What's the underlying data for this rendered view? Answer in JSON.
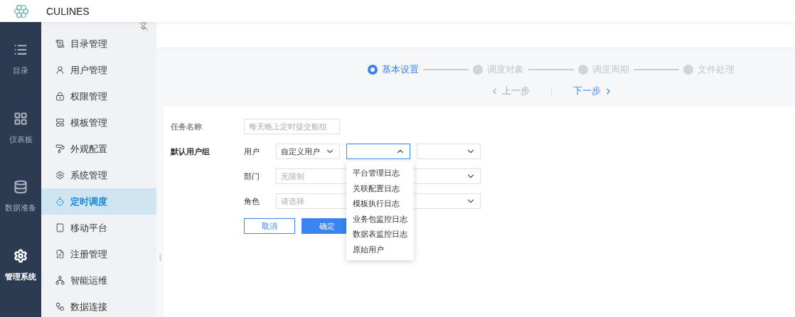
{
  "app": {
    "title": "CULINES"
  },
  "rail": [
    {
      "label": "目录",
      "selected": false
    },
    {
      "label": "仪表板",
      "selected": false
    },
    {
      "label": "数据准备",
      "selected": false
    },
    {
      "label": "管理系统",
      "selected": true
    }
  ],
  "menu": [
    {
      "label": "目录管理",
      "selected": false
    },
    {
      "label": "用户管理",
      "selected": false
    },
    {
      "label": "权限管理",
      "selected": false
    },
    {
      "label": "模板管理",
      "selected": false
    },
    {
      "label": "外观配置",
      "selected": false
    },
    {
      "label": "系统管理",
      "selected": false
    },
    {
      "label": "定时调度",
      "selected": true
    },
    {
      "label": "移动平台",
      "selected": false
    },
    {
      "label": "注册管理",
      "selected": false
    },
    {
      "label": "智能运维",
      "selected": false
    },
    {
      "label": "数据连接",
      "selected": false
    }
  ],
  "steps": [
    {
      "label": "基本设置",
      "selected": true
    },
    {
      "label": "调度对象",
      "selected": false
    },
    {
      "label": "调度周期",
      "selected": false
    },
    {
      "label": "文件处理",
      "selected": false
    }
  ],
  "nav": {
    "prev": {
      "label": "上一步",
      "disabled": true
    },
    "next": {
      "label": "下一步",
      "disabled": false
    }
  },
  "form": {
    "task_name": {
      "label": "任务名称",
      "placeholder": "每天晚上定时提交船组"
    },
    "user_group": {
      "label": "默认用户组",
      "rows": [
        {
          "label": "用户",
          "selects": [
            {
              "value": "自定义用户",
              "open": false
            },
            {
              "open": true,
              "options": [
                "平台管理日志",
                "关联配置日志",
                "模板执行日志",
                "业务包监控日志",
                "数据表监控日志",
                "原始用户"
              ]
            },
            {
              "open": false
            }
          ]
        },
        {
          "label": "部门",
          "selects": [
            {
              "placeholder": "无限制",
              "open": false
            }
          ]
        },
        {
          "label": "角色",
          "selects": [
            {
              "placeholder": "请选择",
              "open": false
            }
          ]
        }
      ]
    },
    "buttons": [
      {
        "label": "取消",
        "kind": "secondary"
      },
      {
        "label": "确定",
        "kind": "primary"
      }
    ]
  }
}
